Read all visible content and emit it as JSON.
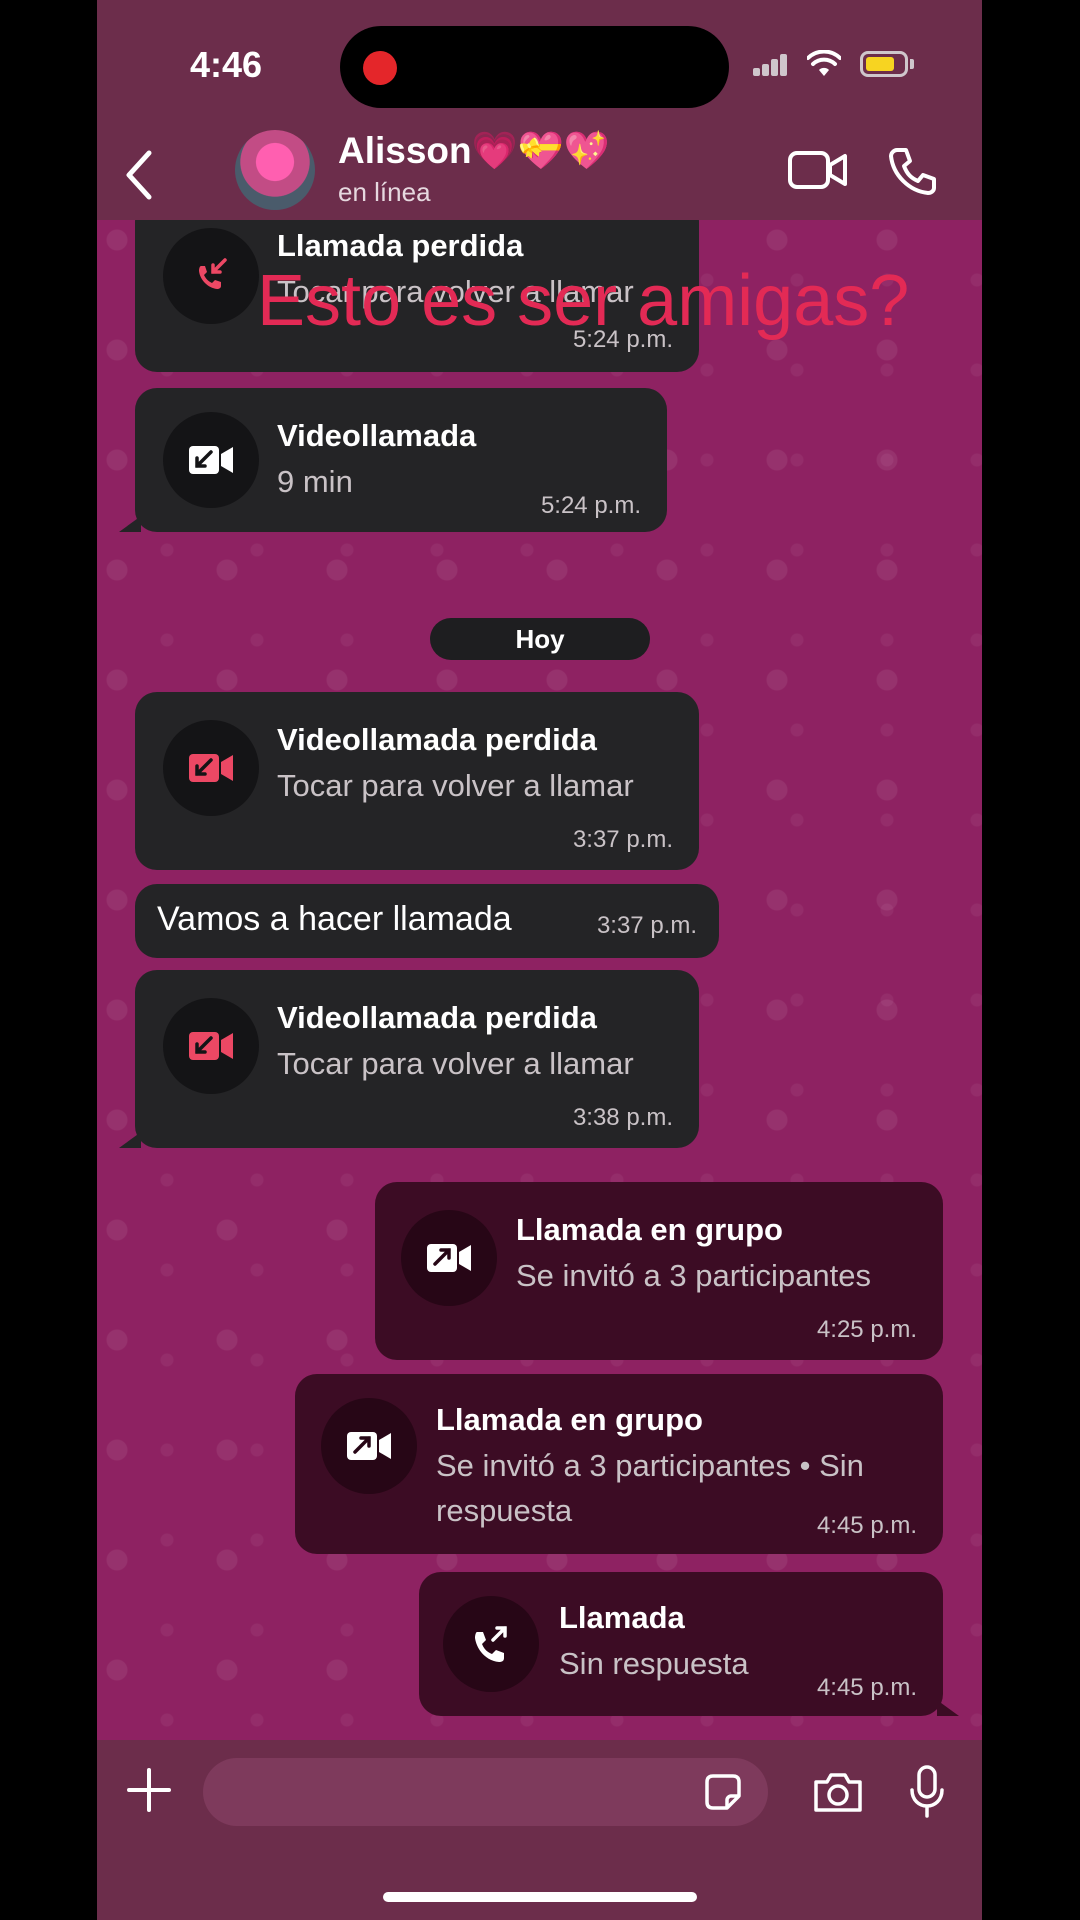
{
  "status_bar": {
    "time": "4:46"
  },
  "header": {
    "contact_name": "Alisson💗💝💖",
    "contact_status": "en línea"
  },
  "overlay_caption": "Esto es ser amigas?",
  "messages": [
    {
      "kind": "call",
      "direction": "in",
      "icon": "missed-call-icon",
      "title": "Llamada perdida",
      "subtitle": "Tocar para volver a llamar",
      "time": "5:24 p.m."
    },
    {
      "kind": "call",
      "direction": "in",
      "icon": "incoming-video-icon",
      "title": "Videollamada",
      "subtitle": "9 min",
      "time": "5:24 p.m."
    },
    {
      "kind": "date",
      "label": "Hoy"
    },
    {
      "kind": "call",
      "direction": "in",
      "icon": "missed-video-icon",
      "title": "Videollamada perdida",
      "subtitle": "Tocar para volver a llamar",
      "time": "3:37 p.m."
    },
    {
      "kind": "text",
      "direction": "in",
      "text": "Vamos a hacer llamada",
      "time": "3:37 p.m."
    },
    {
      "kind": "call",
      "direction": "in",
      "icon": "missed-video-icon",
      "title": "Videollamada perdida",
      "subtitle": "Tocar para volver a llamar",
      "time": "3:38 p.m."
    },
    {
      "kind": "call",
      "direction": "out",
      "icon": "outgoing-video-icon",
      "title": "Llamada en grupo",
      "subtitle": "Se invitó a 3 participantes",
      "time": "4:25 p.m."
    },
    {
      "kind": "call",
      "direction": "out",
      "icon": "outgoing-video-icon",
      "title": "Llamada en grupo",
      "subtitle_line1": "Se invitó a 3 participantes • Sin",
      "subtitle_line2": "respuesta",
      "time": "4:45 p.m."
    },
    {
      "kind": "call",
      "direction": "out",
      "icon": "outgoing-call-icon",
      "title": "Llamada",
      "subtitle": "Sin respuesta",
      "time": "4:45 p.m."
    }
  ],
  "input": {
    "placeholder": ""
  },
  "colors": {
    "accent_missed": "#ec4864",
    "incoming_bubble": "#242426",
    "outgoing_bubble": "#3c0c24",
    "caption": "#e32a55"
  }
}
